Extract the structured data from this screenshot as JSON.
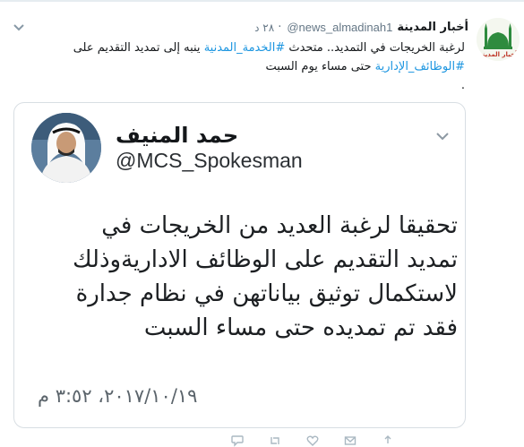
{
  "tweet": {
    "display_name": "أخبار المدينة",
    "handle": "@news_almadinah1",
    "separator": "·",
    "time": "٢٨ د",
    "avatar_label": "أخبار المدينة",
    "text_lines": [
      [
        "لرغبة الخريجات في التمديد.. متحدث ",
        "#الخدمة_المدنية",
        " ينبه إلى تمديد التقديم على"
      ],
      [
        "#الوظائف_الإدارية",
        " حتى مساء يوم السبت"
      ],
      [
        "."
      ]
    ]
  },
  "quoted": {
    "name": "حمد المنيف",
    "handle": "@MCS_Spokesman",
    "body_lines": [
      "تحقيقا لرغبة العديد من الخريجات في",
      "تمديد التقديم على الوظائف الاداريةوذلك",
      "لاستكمال توثيق بياناتهن في نظام جدارة",
      "فقد تم تمديده حتى مساء السبت"
    ],
    "date": "٢٠١٧/١٠/١٩، ٣:٥٢ م"
  },
  "icons": {
    "caret": "chevron-down-icon",
    "reply": "reply-icon",
    "retweet": "retweet-icon",
    "like": "heart-icon",
    "message": "envelope-icon",
    "share": "share-icon"
  },
  "colors": {
    "link": "#1b95e0",
    "text": "#14171a",
    "secondary": "#657786",
    "border": "#d8dee3"
  }
}
